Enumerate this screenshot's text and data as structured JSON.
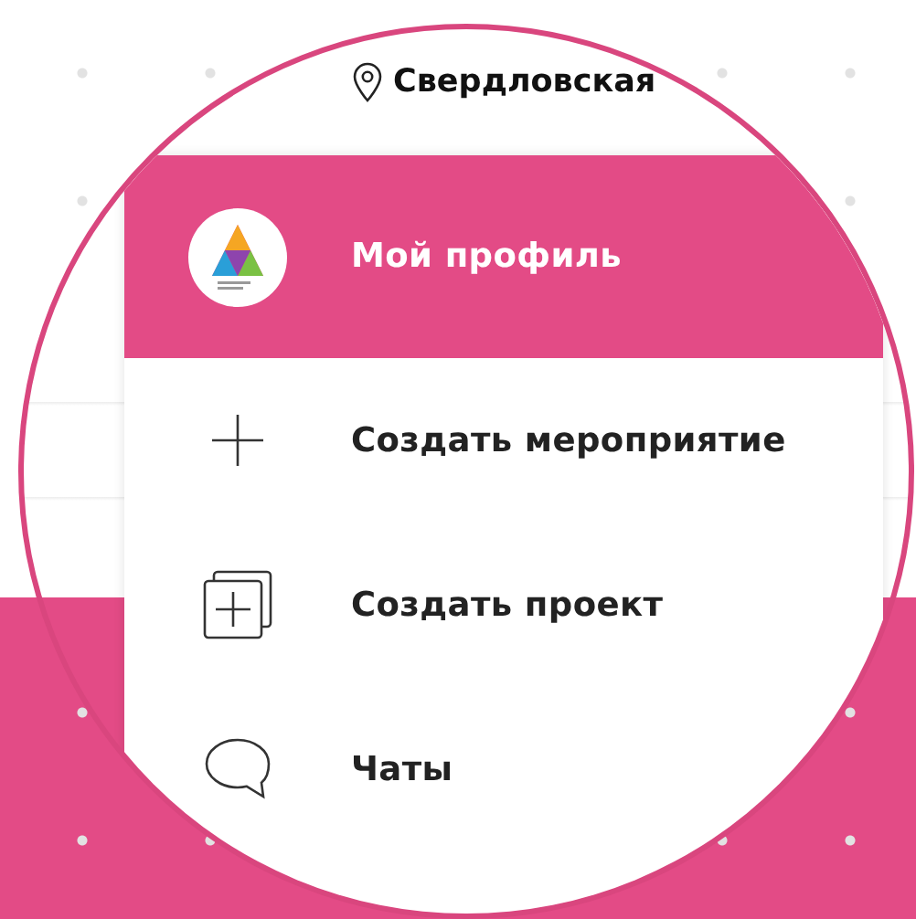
{
  "location": {
    "text": "Свердловская"
  },
  "menu": {
    "items": [
      {
        "kind": "profile",
        "label": "Мой профиль"
      },
      {
        "kind": "add",
        "label": "Создать мероприятие"
      },
      {
        "kind": "project",
        "label": "Создать проект"
      },
      {
        "kind": "chat",
        "label": "Чаты"
      }
    ]
  }
}
